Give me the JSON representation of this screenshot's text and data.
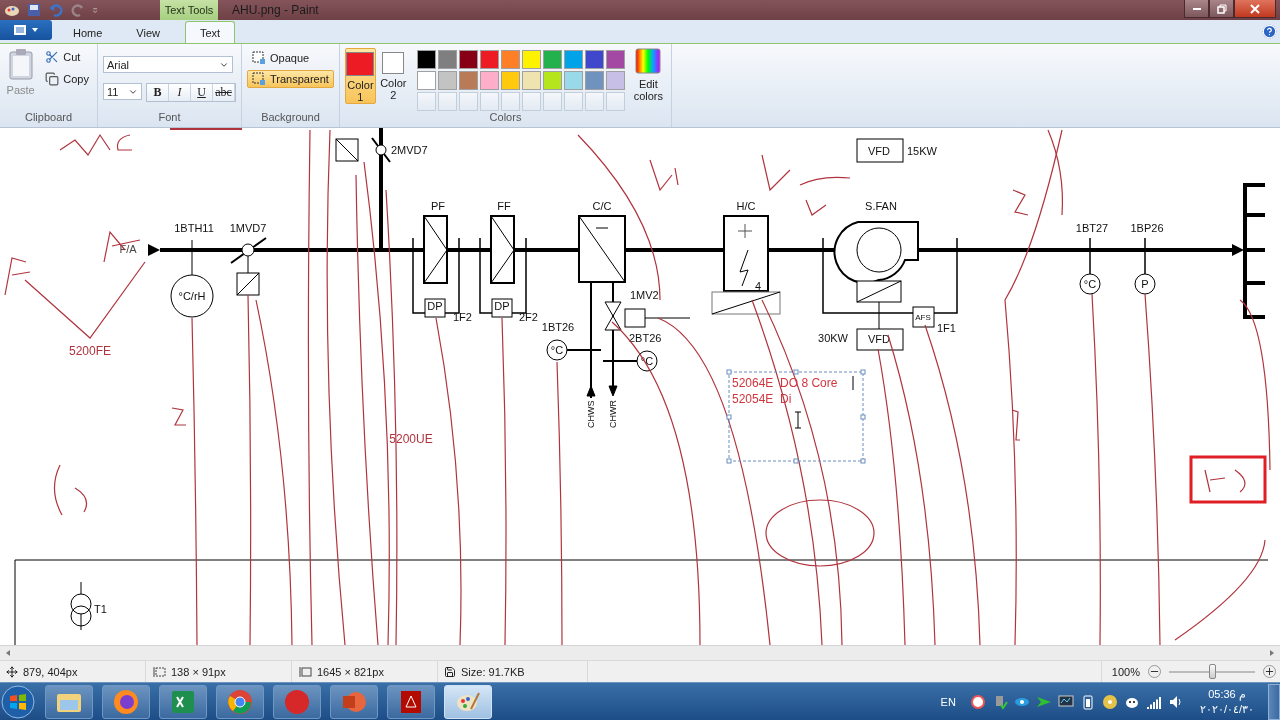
{
  "window": {
    "title": "AHU.png - Paint",
    "contextual_tab": "Text Tools"
  },
  "ribbon_tabs": [
    {
      "label": "Home",
      "selected": false
    },
    {
      "label": "View",
      "selected": false
    },
    {
      "label": "Text",
      "selected": true
    }
  ],
  "clipboard": {
    "group": "Clipboard",
    "paste": "Paste",
    "paste_disabled": true,
    "cut": "Cut",
    "copy": "Copy"
  },
  "font": {
    "group": "Font",
    "family": "Arial",
    "size": "11",
    "styles": [
      {
        "label": "B",
        "kind": "bold"
      },
      {
        "label": "I",
        "kind": "italic"
      },
      {
        "label": "U",
        "kind": "underline"
      },
      {
        "label": "abc",
        "kind": "strike"
      }
    ]
  },
  "background": {
    "group": "Background",
    "options": [
      {
        "label": "Opaque",
        "selected": false
      },
      {
        "label": "Transparent",
        "selected": true
      }
    ]
  },
  "colors": {
    "group": "Colors",
    "slots": [
      {
        "label": "Color 1",
        "selected": true,
        "color": "#ed1c24"
      },
      {
        "label": "Color 2",
        "selected": false,
        "color": "#ffffff"
      }
    ],
    "palette": [
      {
        "kind": "swatch",
        "color": "#000000"
      },
      {
        "kind": "swatch",
        "color": "#7f7f7f"
      },
      {
        "kind": "swatch",
        "color": "#880015"
      },
      {
        "kind": "swatch",
        "color": "#ed1c24"
      },
      {
        "kind": "swatch",
        "color": "#ff7f27"
      },
      {
        "kind": "swatch",
        "color": "#fff200"
      },
      {
        "kind": "swatch",
        "color": "#22b14c"
      },
      {
        "kind": "swatch",
        "color": "#00a2e8"
      },
      {
        "kind": "swatch",
        "color": "#3f48cc"
      },
      {
        "kind": "swatch",
        "color": "#a349a4"
      },
      {
        "kind": "swatch",
        "color": "#ffffff"
      },
      {
        "kind": "swatch",
        "color": "#c3c3c3"
      },
      {
        "kind": "swatch",
        "color": "#b97a57"
      },
      {
        "kind": "swatch",
        "color": "#ffaec9"
      },
      {
        "kind": "swatch",
        "color": "#ffc90e"
      },
      {
        "kind": "swatch",
        "color": "#efe4b0"
      },
      {
        "kind": "swatch",
        "color": "#b5e61d"
      },
      {
        "kind": "swatch",
        "color": "#99d9ea"
      },
      {
        "kind": "swatch",
        "color": "#7092be"
      },
      {
        "kind": "swatch",
        "color": "#c8bfe7"
      },
      {
        "kind": "empty"
      },
      {
        "kind": "empty"
      },
      {
        "kind": "empty"
      },
      {
        "kind": "empty"
      },
      {
        "kind": "empty"
      },
      {
        "kind": "empty"
      },
      {
        "kind": "empty"
      },
      {
        "kind": "empty"
      },
      {
        "kind": "empty"
      },
      {
        "kind": "empty"
      }
    ],
    "edit": "Edit colors"
  },
  "canvas": {
    "labels": [
      "2MVD7",
      "VFD",
      "15KW",
      "PF",
      "FF",
      "C/C",
      "H/C",
      "S.FAN",
      "1BTH11",
      "1MVD7",
      "1BT27",
      "1BP26",
      "F/A",
      "°C/rH",
      "DP",
      "DP",
      "1F2",
      "2F2",
      "1MV2",
      "AFS",
      "1F1",
      "1BT26",
      "2BT26",
      "°C",
      "°C",
      "4",
      "°C",
      "P",
      "30KW",
      "VFD",
      "CHWS",
      "CHWR",
      "T1"
    ],
    "annotations": [
      "5200FE",
      "5200UE"
    ],
    "text_box": {
      "lines": [
        "52064E  DO 8 Core",
        "52054E  Di"
      ]
    }
  },
  "status": {
    "cursor": "879, 404px",
    "selection": "138 × 91px",
    "image_size": "1645 × 821px",
    "file_size": "Size: 91.7KB",
    "zoom": "100%",
    "zoom_slider": {
      "level": 0.5
    }
  },
  "taskbar": {
    "language": "EN",
    "time": "05:36 م",
    "date": "٢٠٢٠/٠٤/٣٠"
  }
}
